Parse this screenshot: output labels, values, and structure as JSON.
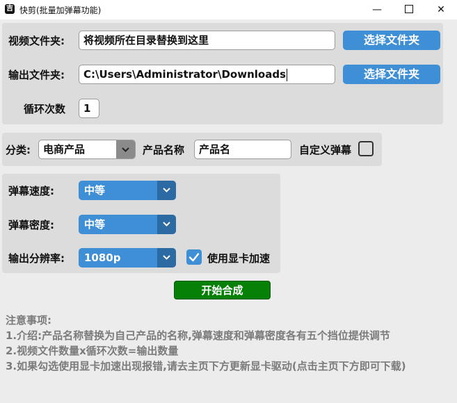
{
  "window": {
    "title": "快剪(批量加弹幕功能)",
    "app_icon": "吉",
    "minimize_glyph": "—",
    "close_glyph": "✕"
  },
  "video_folder": {
    "label": "视频文件夹:",
    "value": "将视频所在目录替换到这里",
    "button": "选择文件夹"
  },
  "output_folder": {
    "label": "输出文件夹:",
    "value": "C:\\Users\\Administrator\\Downloads",
    "button": "选择文件夹"
  },
  "loop": {
    "label": "循环次数",
    "value": "1"
  },
  "category": {
    "label": "分类:",
    "selected": "电商产品",
    "product_label": "产品名称",
    "product_value": "产品名",
    "custom_danmaku_label": "自定义弹幕",
    "custom_danmaku_checked": false
  },
  "danmaku_speed": {
    "label": "弹幕速度:",
    "selected": "中等"
  },
  "danmaku_density": {
    "label": "弹幕密度:",
    "selected": "中等"
  },
  "resolution": {
    "label": "输出分辨率:",
    "selected": "1080p"
  },
  "gpu": {
    "label": "使用显卡加速",
    "checked": true
  },
  "start_button": "开始合成",
  "notes": {
    "title": "注意事项:",
    "lines": [
      "1.介绍:产品名称替换为自己产品的名称,弹幕速度和弹幕密度各有五个挡位提供调节",
      "2.视频文件数量x循环次数=输出数量",
      "3.如果勾选使用显卡加速出现报错,请去主页下方更新显卡驱动(点击主页下方即可下载)"
    ]
  },
  "colors": {
    "accent_blue": "#3f8fd6",
    "dark_blue": "#2c6aa3",
    "start_green": "#078007",
    "panel_gray": "#dcdcdc",
    "note_gray": "#7b7b7b"
  }
}
